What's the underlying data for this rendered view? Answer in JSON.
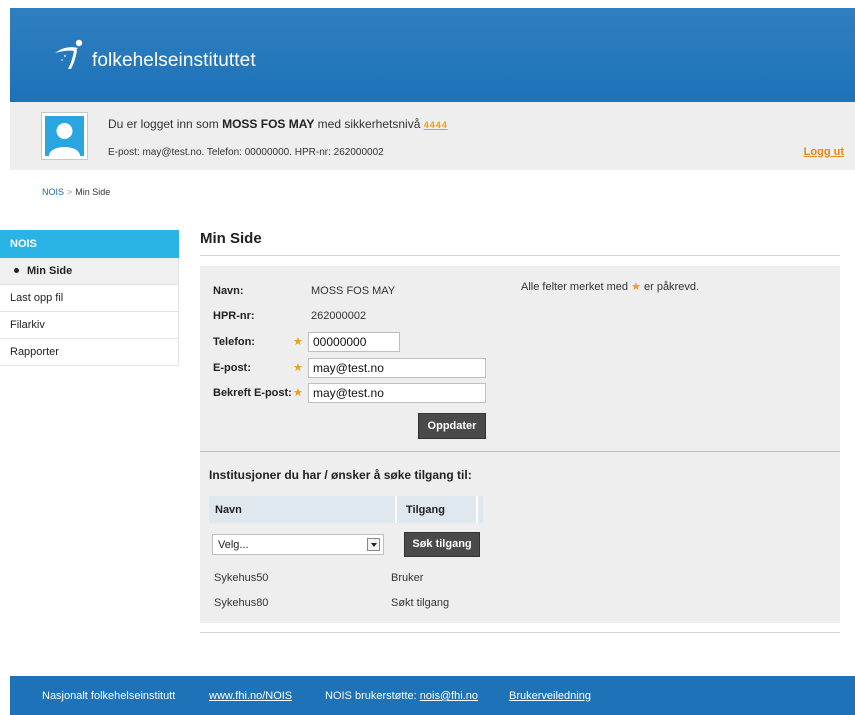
{
  "header": {
    "brand_name": "folkehelseinstituttet",
    "brand_colors": {
      "primary": "#1d72b8",
      "sidebar_header": "#2ab4e5",
      "accent": "#f39c12"
    }
  },
  "user": {
    "login_prefix": "Du er logget inn som",
    "name": "MOSS FOS MAY",
    "security_prefix": "med sikkerhetsnivå",
    "security_level": "4444",
    "contact_line": "E-post: may@test.no.   Telefon: 00000000.   HPR-nr: 262000002",
    "logout_label": "Logg ut"
  },
  "breadcrumb": {
    "root": "NOIS",
    "separator": ">",
    "current": "Min Side"
  },
  "sidebar": {
    "header": "NOIS",
    "items": [
      {
        "label": "Min Side",
        "active": true
      },
      {
        "label": "Last opp fil"
      },
      {
        "label": "Filarkiv"
      },
      {
        "label": "Rapporter"
      }
    ]
  },
  "main": {
    "title": "Min Side",
    "required_note_prefix": "Alle felter merket med",
    "required_note_star": "★",
    "required_note_suffix": "er påkrevd.",
    "form": {
      "name_label": "Navn:",
      "name_value": "MOSS FOS MAY",
      "hpr_label": "HPR-nr:",
      "hpr_value": "262000002",
      "phone_label": "Telefon:",
      "phone_value": "00000000",
      "email_label": "E-post:",
      "email_value": "may@test.no",
      "confirm_email_label": "Bekreft E-post:",
      "confirm_email_value": "may@test.no",
      "required_star": "★",
      "update_button": "Oppdater"
    },
    "institutions": {
      "title": "Institusjoner du har / ønsker å søke tilgang til:",
      "col_name": "Navn",
      "col_access": "Tilgang",
      "select_value": "Velg...",
      "request_button": "Søk tilgang",
      "rows": [
        {
          "name": "Sykehus50",
          "access": "Bruker"
        },
        {
          "name": "Sykehus80",
          "access": "Søkt tilgang"
        }
      ]
    }
  },
  "footer": {
    "org": "Nasjonalt folkehelseinstitutt",
    "link": "www.fhi.no/NOIS",
    "support_prefix": "NOIS brukerstøtte:",
    "support_email": "nois@fhi.no",
    "guide": "Brukerveiledning"
  }
}
